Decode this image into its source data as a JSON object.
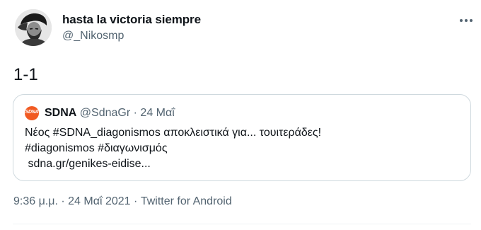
{
  "tweet": {
    "author": {
      "display_name": "hasta la victoria siempre",
      "handle": "@_Nikosmp"
    },
    "text": "1-1",
    "more_icon": "more-horizontal-icon"
  },
  "quote": {
    "logo_text": "SDNA",
    "author": "SDNA",
    "handle": "@SdnaGr",
    "separator": "·",
    "date": "24 Μαΐ",
    "lines": [
      "Νέος #SDNA_diagonismos αποκλειστικά για... τουιτεράδες!",
      "#diagonismos #διαγωνισμός",
      " sdna.gr/genikes-eidise..."
    ],
    "brand_color": "#f15a22"
  },
  "meta": {
    "time": "9:36 μ.μ.",
    "separator": "·",
    "date": "24 Μαΐ 2021",
    "source": "Twitter for Android"
  }
}
